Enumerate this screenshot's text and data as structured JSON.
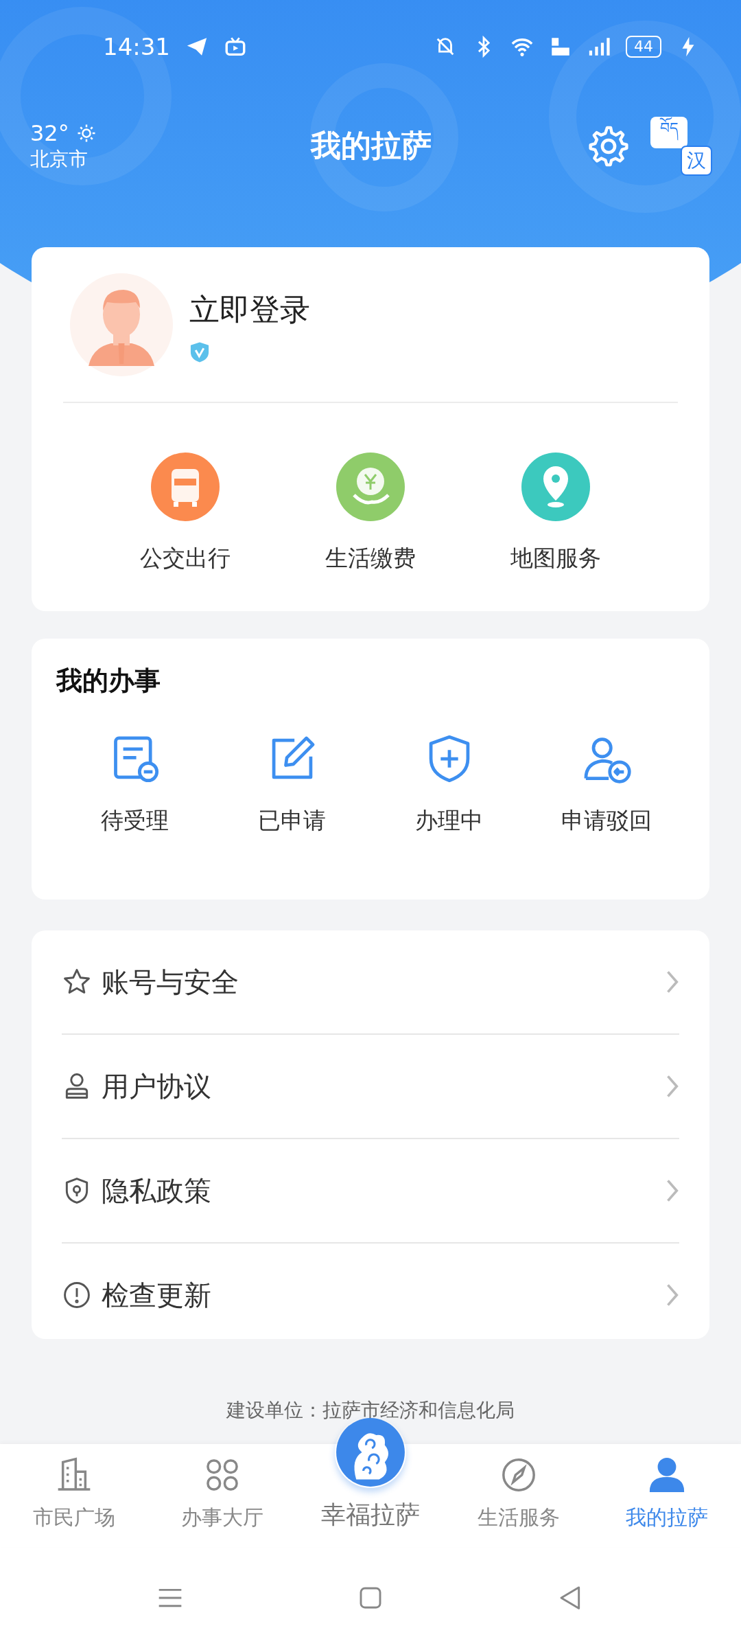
{
  "status_bar": {
    "time": "14:31",
    "battery": "44"
  },
  "header": {
    "temperature": "32°",
    "city": "北京市",
    "title": "我的拉萨",
    "lang_from": "བོད",
    "lang_to": "汉"
  },
  "profile": {
    "login": "立即登录",
    "verified": true
  },
  "quick_services": [
    {
      "label": "公交出行",
      "kind": "bus",
      "color": "#fb8a4e"
    },
    {
      "label": "生活缴费",
      "kind": "pay",
      "color": "#8fcc6a"
    },
    {
      "label": "地图服务",
      "kind": "map",
      "color": "#3cc9be"
    }
  ],
  "affairs": {
    "title": "我的办事",
    "items": [
      {
        "label": "待受理",
        "kind": "pending"
      },
      {
        "label": "已申请",
        "kind": "applied"
      },
      {
        "label": "办理中",
        "kind": "processing"
      },
      {
        "label": "申请驳回",
        "kind": "rejected"
      }
    ]
  },
  "menu": [
    {
      "label": "账号与安全",
      "kind": "star"
    },
    {
      "label": "用户协议",
      "kind": "user"
    },
    {
      "label": "隐私政策",
      "kind": "shield"
    },
    {
      "label": "检查更新",
      "kind": "alert"
    }
  ],
  "footer": "建设单位：拉萨市经济和信息化局",
  "tabs": [
    {
      "label": "市民广场",
      "kind": "building",
      "selected": false
    },
    {
      "label": "办事大厅",
      "kind": "grid",
      "selected": false
    },
    {
      "label": "幸福拉萨",
      "kind": "center",
      "selected": false
    },
    {
      "label": "生活服务",
      "kind": "compass",
      "selected": false
    },
    {
      "label": "我的拉萨",
      "kind": "person",
      "selected": true
    }
  ]
}
